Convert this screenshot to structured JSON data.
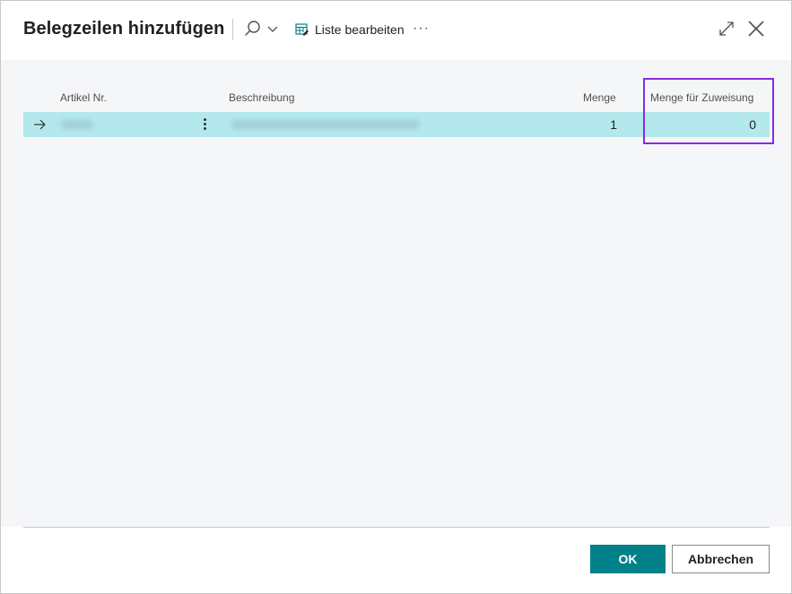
{
  "dialog": {
    "title": "Belegzeilen hinzufügen",
    "toolbar": {
      "search_icon": "search-icon",
      "edit_list_label": "Liste bearbeiten",
      "edit_list_icon": "edit-table-icon",
      "more_label": "···"
    }
  },
  "table": {
    "columns": [
      "Artikel Nr.",
      "Beschreibung",
      "Menge",
      "Menge für Zuweisung"
    ],
    "rows": [
      {
        "artikel_nr": "",
        "beschreibung": "",
        "menge": "1",
        "menge_fuer_zuweisung": "0"
      }
    ]
  },
  "footer": {
    "ok_label": "OK",
    "cancel_label": "Abbrechen"
  },
  "colors": {
    "accent": "#00818a",
    "selected_row": "#b3e8ec",
    "highlight_border": "#8a2be2",
    "content_bg": "#f5f6f8"
  }
}
